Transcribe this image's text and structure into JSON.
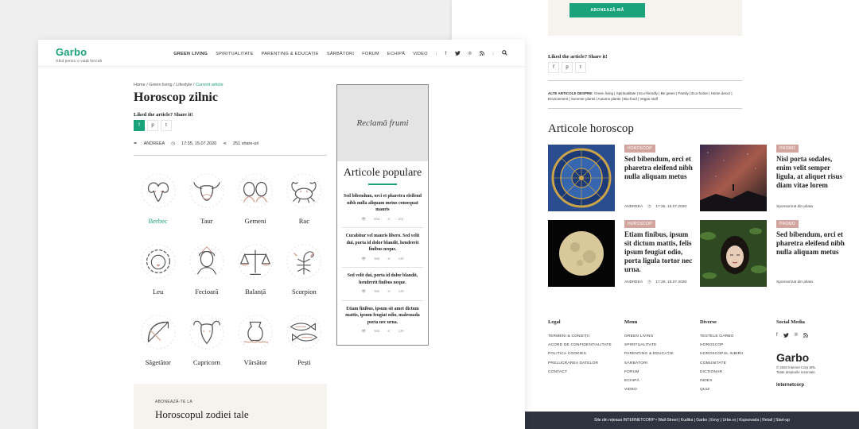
{
  "left": {
    "logo": {
      "name": "Garbo",
      "tagline": "Ghid pentru o viață fericită"
    },
    "menu": [
      "GREEN LIVING",
      "SPIRITUALITATE",
      "PARENTING & EDUCAȚIE",
      "SĂRBĂTORI",
      "FORUM",
      "ECHIPĂ",
      "VIDEO"
    ],
    "breadcrumb": {
      "home": "Home",
      "green": "Green living",
      "life": "Lifestyle",
      "current": "Current article",
      "sep": " / "
    },
    "title": "Horoscop zilnic",
    "share_label": "Liked the article? Share it!",
    "share_icons": [
      "f",
      "p",
      "t"
    ],
    "meta": {
      "author": "ANDREEA",
      "datetime": "17:35, 15.07.2020",
      "shares": "251 share-uri"
    },
    "zodiac": [
      "Berbec",
      "Taur",
      "Gemeni",
      "Rac",
      "Leu",
      "Fecioară",
      "Balanță",
      "Scorpion",
      "Săgetător",
      "Capricorn",
      "Vărsător",
      "Pești"
    ],
    "ad": {
      "text": "Reclamă frumi"
    },
    "popular": {
      "title": "Articole populare",
      "items": [
        {
          "text": "Sed bibendum, orci et pharetra eleifend  nibh nulla aliquam metus consequat mauris",
          "views": "654",
          "shares": "251"
        },
        {
          "text": "Curabitur vel mauris libero. Sed velit dui, porta id dolor blandit, hendrerit finibus neque.",
          "views": "360",
          "shares": "129"
        },
        {
          "text": "Sed velit dui, porta id dolor blandit, hendrerit finibus neque.",
          "views": "360",
          "shares": "129"
        },
        {
          "text": "Etiam finibus, ipsum sit amet dictum mattis, ipsum feugiat odio, malesuada porta nec urna.",
          "views": "360",
          "shares": "129"
        }
      ]
    },
    "subscribe": {
      "kicker": "ABONEAZĂ-TE LA",
      "title": "Horoscopul zodiei tale"
    }
  },
  "right": {
    "button": "ABONEAZĂ-MĂ",
    "share_label": "Liked the article? Share it!",
    "tags_label": "ALTE ARTICOLE DESPRE:",
    "tags": "Green living | Spiritualitate | Eco-friendly | Be green | Family | Eco-home | Home decor | Environment | Summer plants | Autumn plants | Bio-food | Vegan stuff",
    "section_title": "Articole horoscop",
    "cards": [
      {
        "label": "HOROSCOP",
        "title": "Sed bibendum, orci et pharetra eleifend nibh nulla aliquam metus",
        "author": "ANDREEA",
        "date": "17:35, 15.07.2020"
      },
      {
        "label": "PROMO",
        "title": "Nisl porta sodales, enim velit semper ligula, at aliquet risus diam vitae lorem",
        "sponsor": "Sponsorizat din pliata"
      },
      {
        "label": "HOROSCOP",
        "title": "Etiam finibus, ipsum sit dictum mattis, felis ipsum feugiat odio, porta ligula tortor nec urna.",
        "author": "ANDREEA",
        "date": "17:35, 15.07.2020"
      },
      {
        "label": "PROMO",
        "title": "Sed bibendum, orci et pharetra eleifend nibh nulla aliquam metus",
        "sponsor": "Sponsorizat din pliata"
      }
    ],
    "footer": {
      "legal": {
        "title": "Legal",
        "items": [
          "TERMENI & CONDIȚII",
          "ACORD DE CONFIDENȚIALITATE",
          "POLITICA COOKIES",
          "PRELUCRAREA DATELOR",
          "CONTACT"
        ]
      },
      "menu": {
        "title": "Menu",
        "items": [
          "GREEN LIVING",
          "SPIRITUALITATE",
          "PARENTING & EDUCAȚIE",
          "SĂRBĂTORI",
          "FORUM",
          "ECHIPĂ",
          "VIDEO"
        ]
      },
      "diverse": {
        "title": "Diverse",
        "items": [
          "TESTELE GARBO",
          "HOROSCOP",
          "HOROSCOPUL IUBIRII",
          "COMUNITATE",
          "DICȚIONAR",
          "INDEX",
          "QUIZ"
        ]
      },
      "social": {
        "title": "Social Media"
      },
      "logo": "Garbo",
      "copy1": "© 2020 Internet Corp SRL",
      "copy2": "Toate drepturile rezervate",
      "ic_logo": "Internetcorp"
    },
    "bottom_bar": "Site din rețeaua INTERNETCORP • Wall-Street | Kudika | Garbo | Envy | Urbe.ro | Kupsovada | Retail | Start-up"
  },
  "colors": {
    "accent": "#1aa37a",
    "label": "#d2a59e",
    "footer_bar": "#2f3440",
    "beige": "#f6f3ee"
  }
}
